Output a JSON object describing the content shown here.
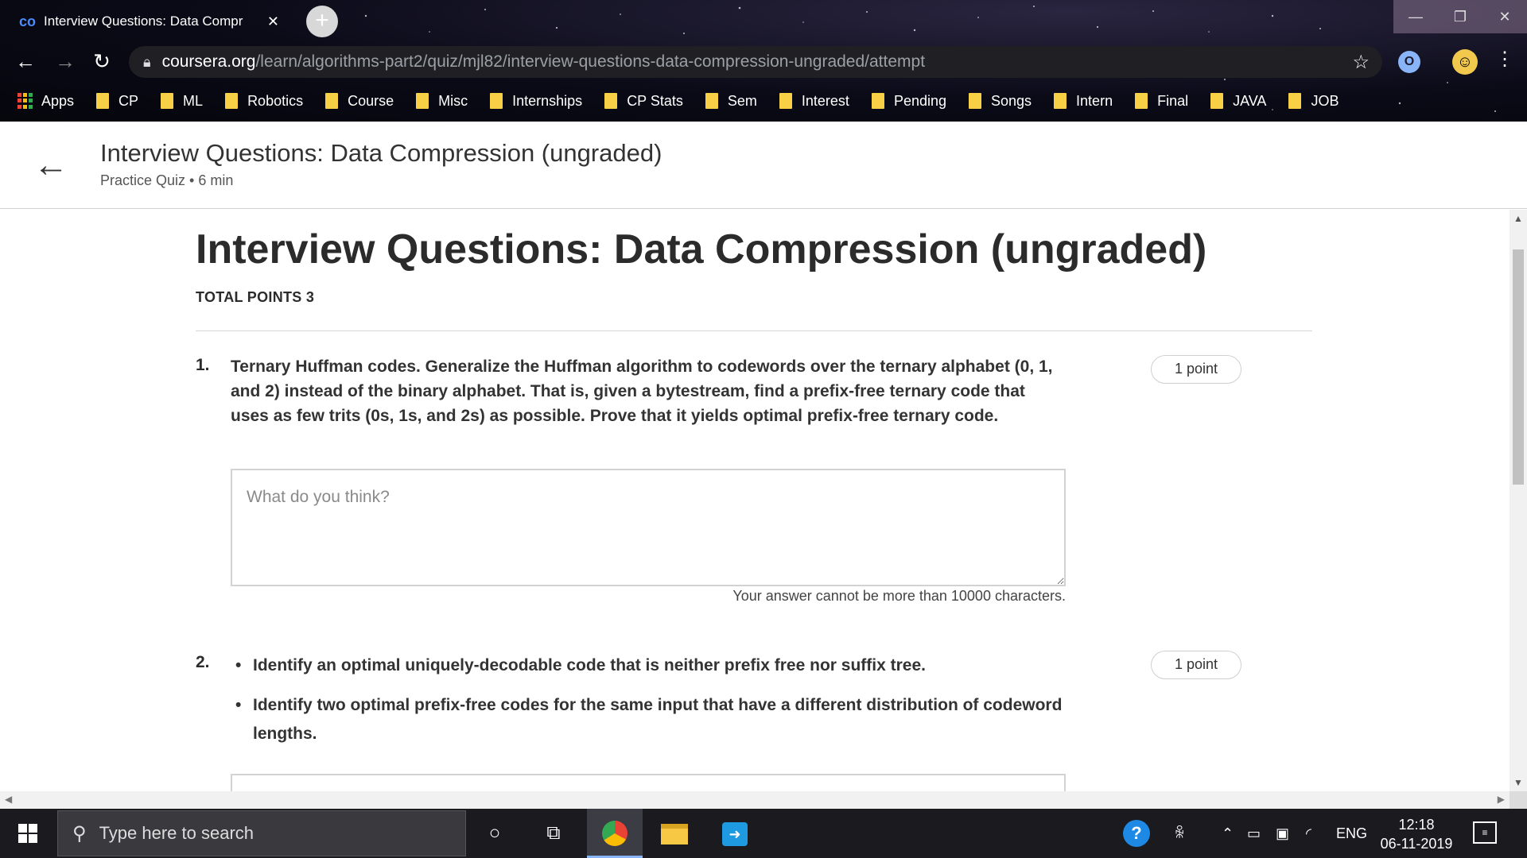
{
  "browser": {
    "tab_title": "Interview Questions: Data Compr",
    "tab_favicon": "co",
    "url_host": "coursera.org",
    "url_path": "/learn/algorithms-part2/quiz/mjl82/interview-questions-data-compression-ungraded/attempt",
    "bookmarks": [
      "Apps",
      "CP",
      "ML",
      "Robotics",
      "Course",
      "Misc",
      "Internships",
      "CP Stats",
      "Sem",
      "Interest",
      "Pending",
      "Songs",
      "Intern",
      "Final",
      "JAVA",
      "JOB"
    ]
  },
  "header": {
    "title": "Interview Questions: Data Compression (ungraded)",
    "subtitle": "Practice Quiz • 6 min"
  },
  "quiz": {
    "title": "Interview Questions: Data Compression (ungraded)",
    "total_points": "TOTAL POINTS 3",
    "questions": [
      {
        "number": "1.",
        "text": "Ternary Huffman codes. Generalize the Huffman algorithm to codewords over the ternary alphabet (0, 1, and 2) instead of the binary alphabet. That is, given a bytestream, find a prefix-free ternary code that uses as few trits (0s, 1s, and 2s) as possible. Prove that it yields optimal prefix-free ternary code.",
        "points": "1 point",
        "placeholder": "What do you think?",
        "limit_note": "Your answer cannot be more than 10000 characters."
      },
      {
        "number": "2.",
        "bullets": [
          "Identify an optimal uniquely-decodable code that is neither prefix free nor suffix tree.",
          "Identify two optimal prefix-free codes for the same input that have a different distribution of codeword lengths."
        ],
        "points": "1 point"
      }
    ]
  },
  "taskbar": {
    "search_placeholder": "Type here to search",
    "language": "ENG",
    "time": "12:18",
    "date": "06-11-2019"
  },
  "colors": {
    "bookmark_folder": "#f7d046",
    "accent_blue": "#4a8cff"
  }
}
